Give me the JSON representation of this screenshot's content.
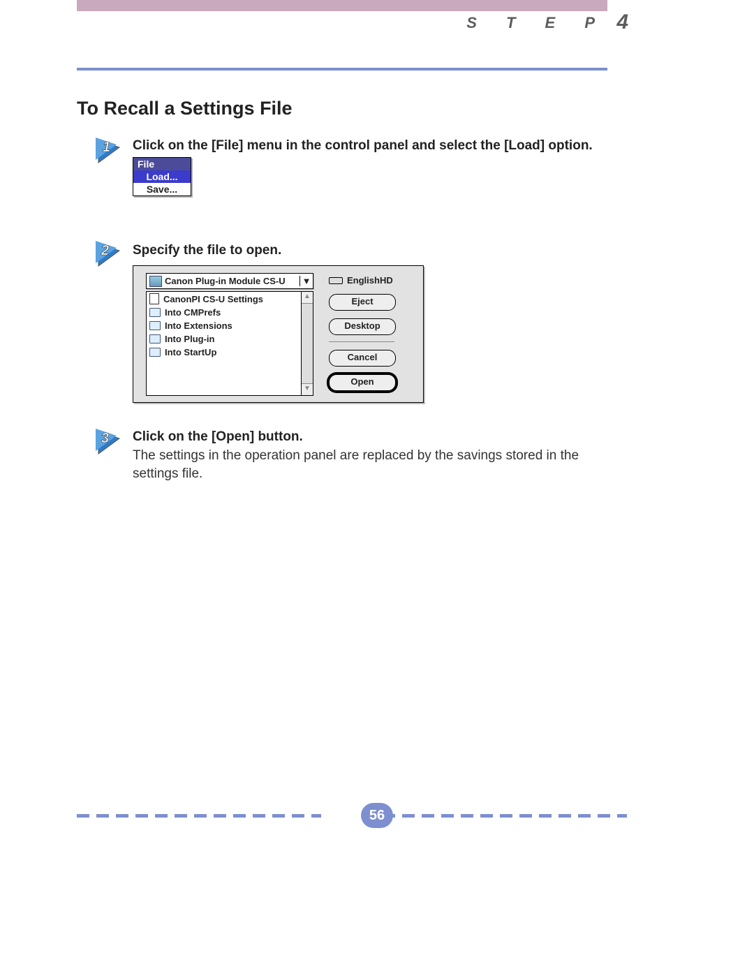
{
  "header": {
    "step_label": "S T E P",
    "step_num": "4"
  },
  "title": "To Recall a Settings File",
  "step1": {
    "text": "Click on the [File] menu in the control panel and select the [Load] option."
  },
  "file_menu": {
    "header": "File",
    "items": [
      "Load...",
      "Save..."
    ]
  },
  "step2": {
    "text": "Specify the file to open."
  },
  "dialog": {
    "popup_label": "Canon Plug-in Module CS-U",
    "disk_label": "EnglishHD",
    "files": [
      {
        "name": "CanonPI CS-U Settings",
        "type": "doc"
      },
      {
        "name": "Into CMPrefs",
        "type": "folder"
      },
      {
        "name": "Into Extensions",
        "type": "folder"
      },
      {
        "name": "Into Plug-in",
        "type": "folder"
      },
      {
        "name": "Into StartUp",
        "type": "folder"
      }
    ],
    "buttons": {
      "eject": "Eject",
      "desktop": "Desktop",
      "cancel": "Cancel",
      "open": "Open"
    }
  },
  "step3": {
    "heading": "Click on the [Open] button.",
    "desc": "The settings in the operation panel are replaced by the savings stored in the settings file."
  },
  "page_number": "56"
}
